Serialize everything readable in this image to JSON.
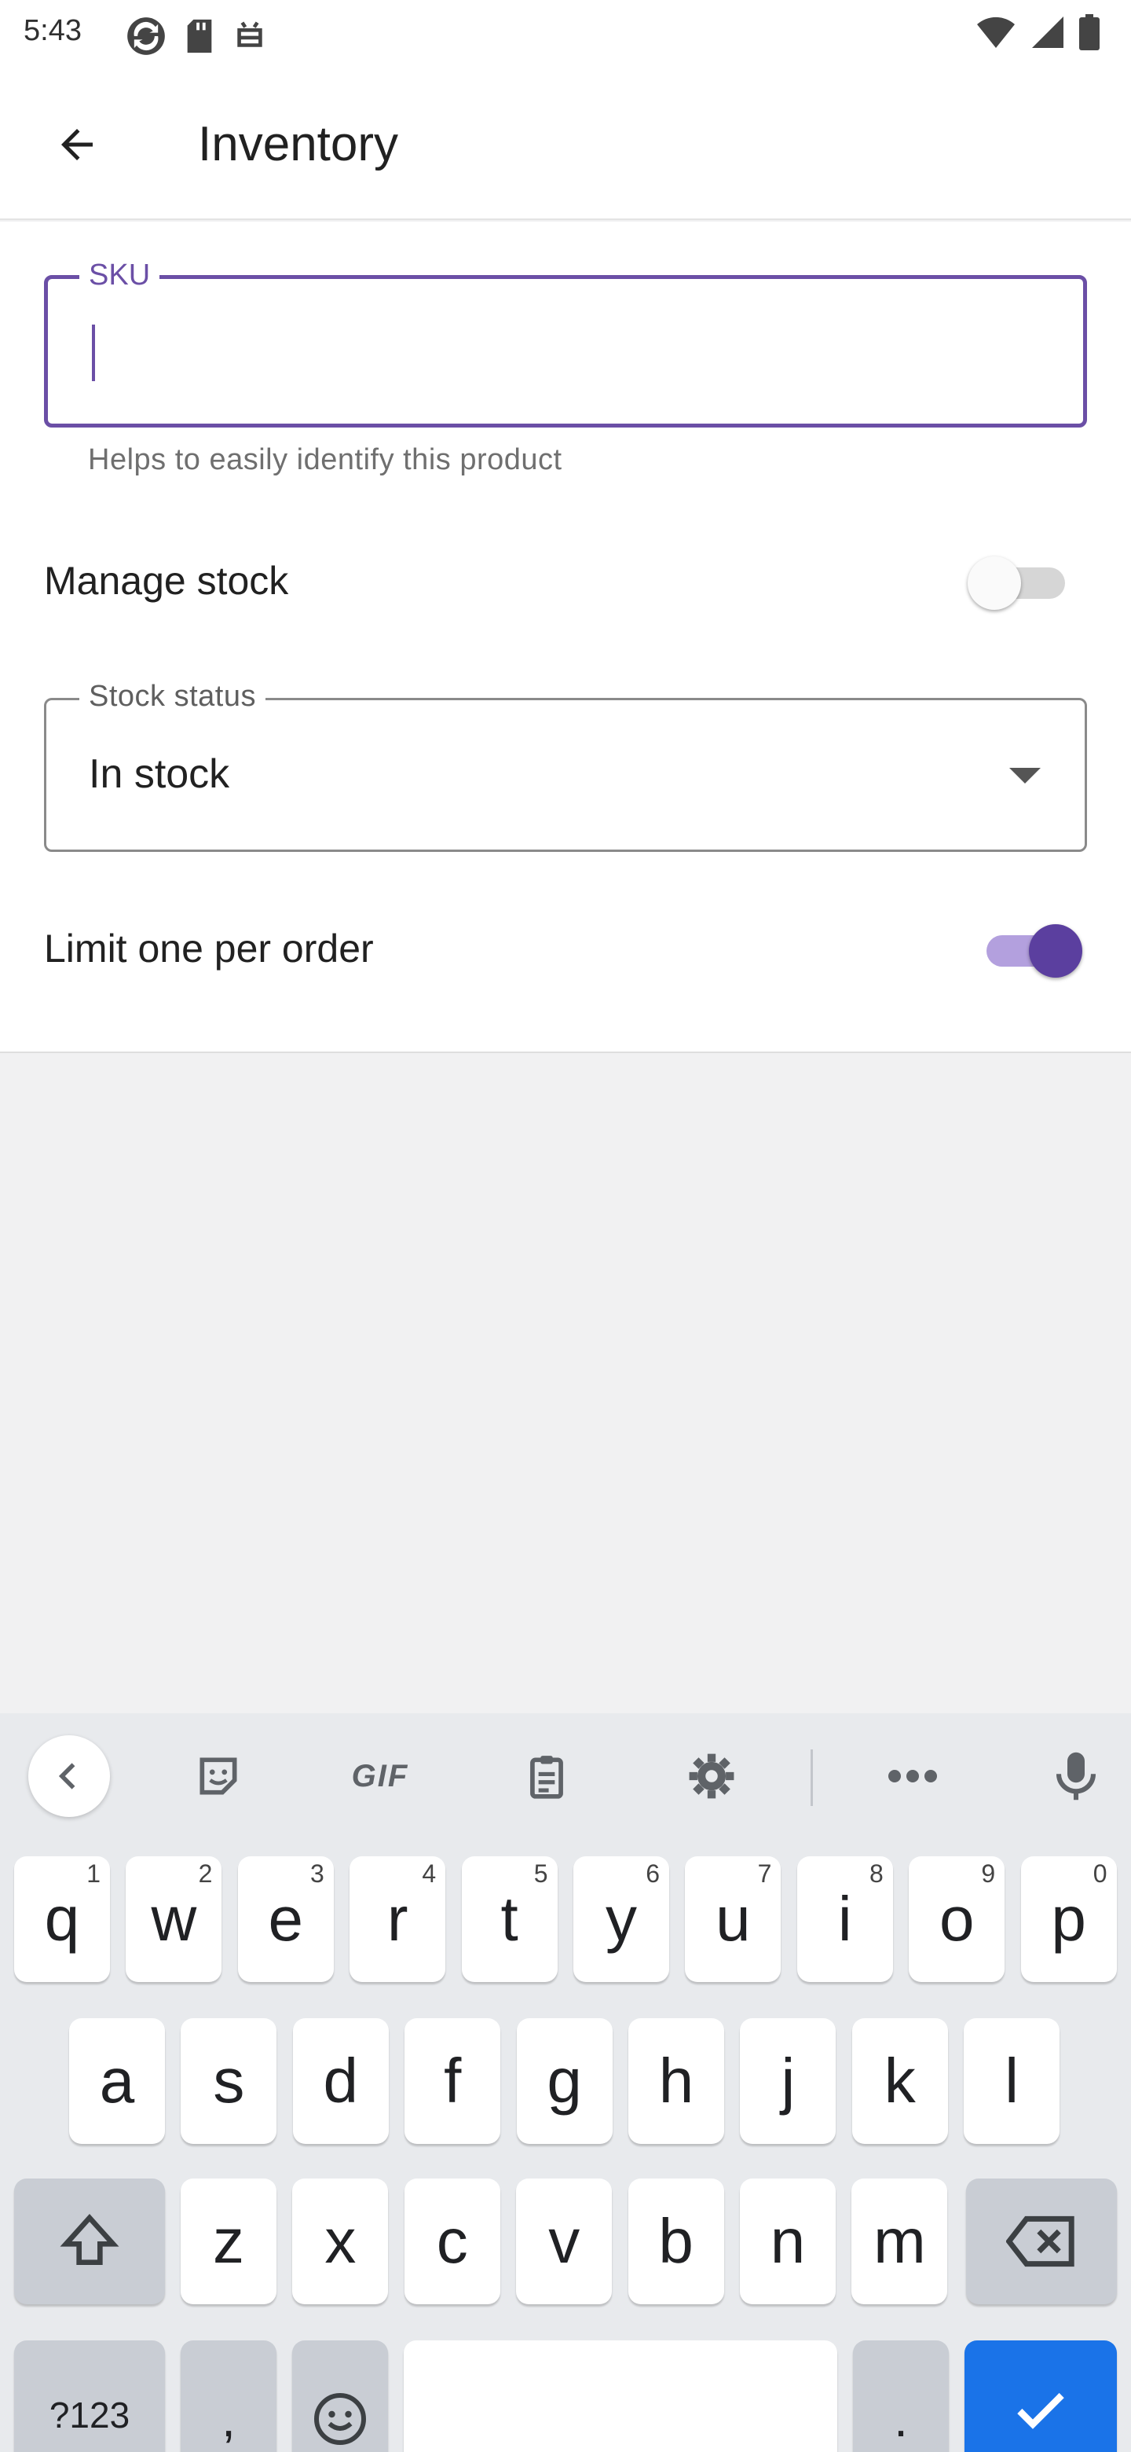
{
  "status_bar": {
    "time": "5:43"
  },
  "app_bar": {
    "title": "Inventory",
    "back_icon": "arrow-back-icon"
  },
  "form": {
    "sku": {
      "label": "SKU",
      "value": "",
      "helper": "Helps to easily identify this product"
    },
    "manage_stock": {
      "label": "Manage stock",
      "enabled": false
    },
    "stock_status": {
      "label": "Stock status",
      "value": "In stock"
    },
    "limit_one_per_order": {
      "label": "Limit one per order",
      "enabled": true
    }
  },
  "colors": {
    "accent": "#6b4fa6",
    "switch_on_thumb": "#5b3f9f",
    "switch_on_track": "#b3a0de",
    "keyboard_action": "#1a73e8"
  },
  "keyboard": {
    "toolbar_icons": [
      "collapse-icon",
      "sticker-icon",
      "gif-icon",
      "clipboard-icon",
      "settings-icon",
      "more-icon",
      "microphone-icon"
    ],
    "gif_label": "GIF",
    "row1": [
      {
        "key": "q",
        "hint": "1"
      },
      {
        "key": "w",
        "hint": "2"
      },
      {
        "key": "e",
        "hint": "3"
      },
      {
        "key": "r",
        "hint": "4"
      },
      {
        "key": "t",
        "hint": "5"
      },
      {
        "key": "y",
        "hint": "6"
      },
      {
        "key": "u",
        "hint": "7"
      },
      {
        "key": "i",
        "hint": "8"
      },
      {
        "key": "o",
        "hint": "9"
      },
      {
        "key": "p",
        "hint": "0"
      }
    ],
    "row2": [
      "a",
      "s",
      "d",
      "f",
      "g",
      "h",
      "j",
      "k",
      "l"
    ],
    "row3": [
      "z",
      "x",
      "c",
      "v",
      "b",
      "n",
      "m"
    ],
    "symbols_label": "?123",
    "comma_label": ",",
    "period_label": "."
  }
}
